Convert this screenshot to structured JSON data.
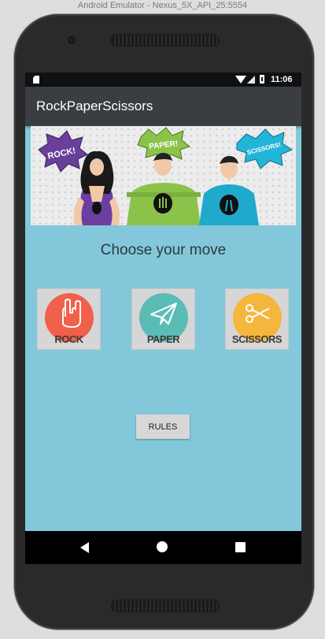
{
  "window": {
    "title": "Android Emulator - Nexus_5X_API_25:5554"
  },
  "status_bar": {
    "time": "11:06",
    "icons": [
      "sd-card-icon",
      "wifi-icon",
      "signal-icon",
      "battery-icon"
    ]
  },
  "app_bar": {
    "title": "RockPaperScissors"
  },
  "banner": {
    "bubbles": [
      "ROCK!",
      "PAPER!",
      "SCISSORS!"
    ]
  },
  "main": {
    "prompt": "Choose your move",
    "moves": [
      {
        "label": "ROCK",
        "icon": "rock-hand-icon",
        "color": "#f0604b"
      },
      {
        "label": "PAPER",
        "icon": "paper-plane-icon",
        "color": "#5bbcb6"
      },
      {
        "label": "SCISSORS",
        "icon": "scissors-icon",
        "color": "#f5b63e"
      }
    ],
    "rules_label": "RULES"
  },
  "nav_bar": {
    "icons": [
      "back-icon",
      "home-icon",
      "recents-icon"
    ]
  },
  "colors": {
    "screen_bg": "#82c8da",
    "app_bar": "#3a3d41",
    "status_bar": "#101013"
  }
}
